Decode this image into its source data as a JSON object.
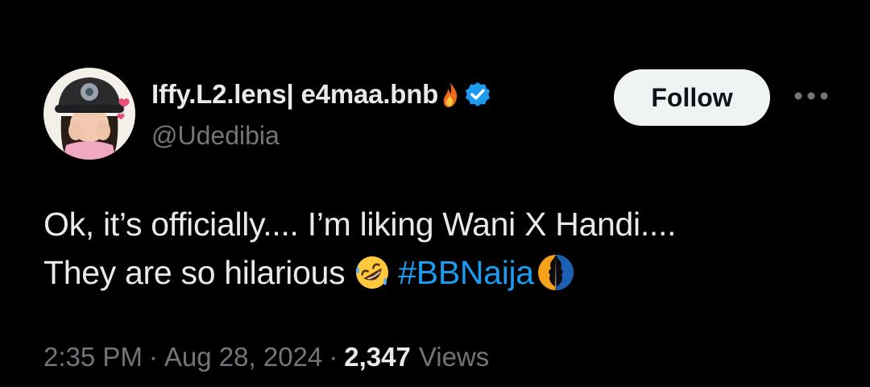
{
  "tweet": {
    "author": {
      "display_name": "Iffy.L2.lens| e4maa.bnb",
      "handle": "@Udedibia",
      "avatar_icon": "avatar-image",
      "badge_icon": "verified-icon",
      "badge_color": "#1d9bf0",
      "name_emoji": "fire-emoji"
    },
    "follow_label": "Follow",
    "more_icon": "more-options-icon",
    "text_line1": "Ok, it’s officially.... I’m liking Wani X Handi....",
    "text_line2": "They are so hilarious",
    "text_emoji": "rolling-on-floor-laughing-emoji",
    "hashtag": "#BBNaija",
    "hashtag_emoji": "bbnaija-hashflag-emoji",
    "time": "2:35 PM",
    "separator": "·",
    "date": "Aug 28, 2024",
    "views_count": "2,347",
    "views_label": "Views"
  },
  "colors": {
    "background": "#000000",
    "primary_text": "#e7e9ea",
    "secondary_text": "#71767b",
    "accent": "#1d9bf0",
    "follow_button_bg": "#eff3f4",
    "follow_button_text": "#0f1419"
  }
}
